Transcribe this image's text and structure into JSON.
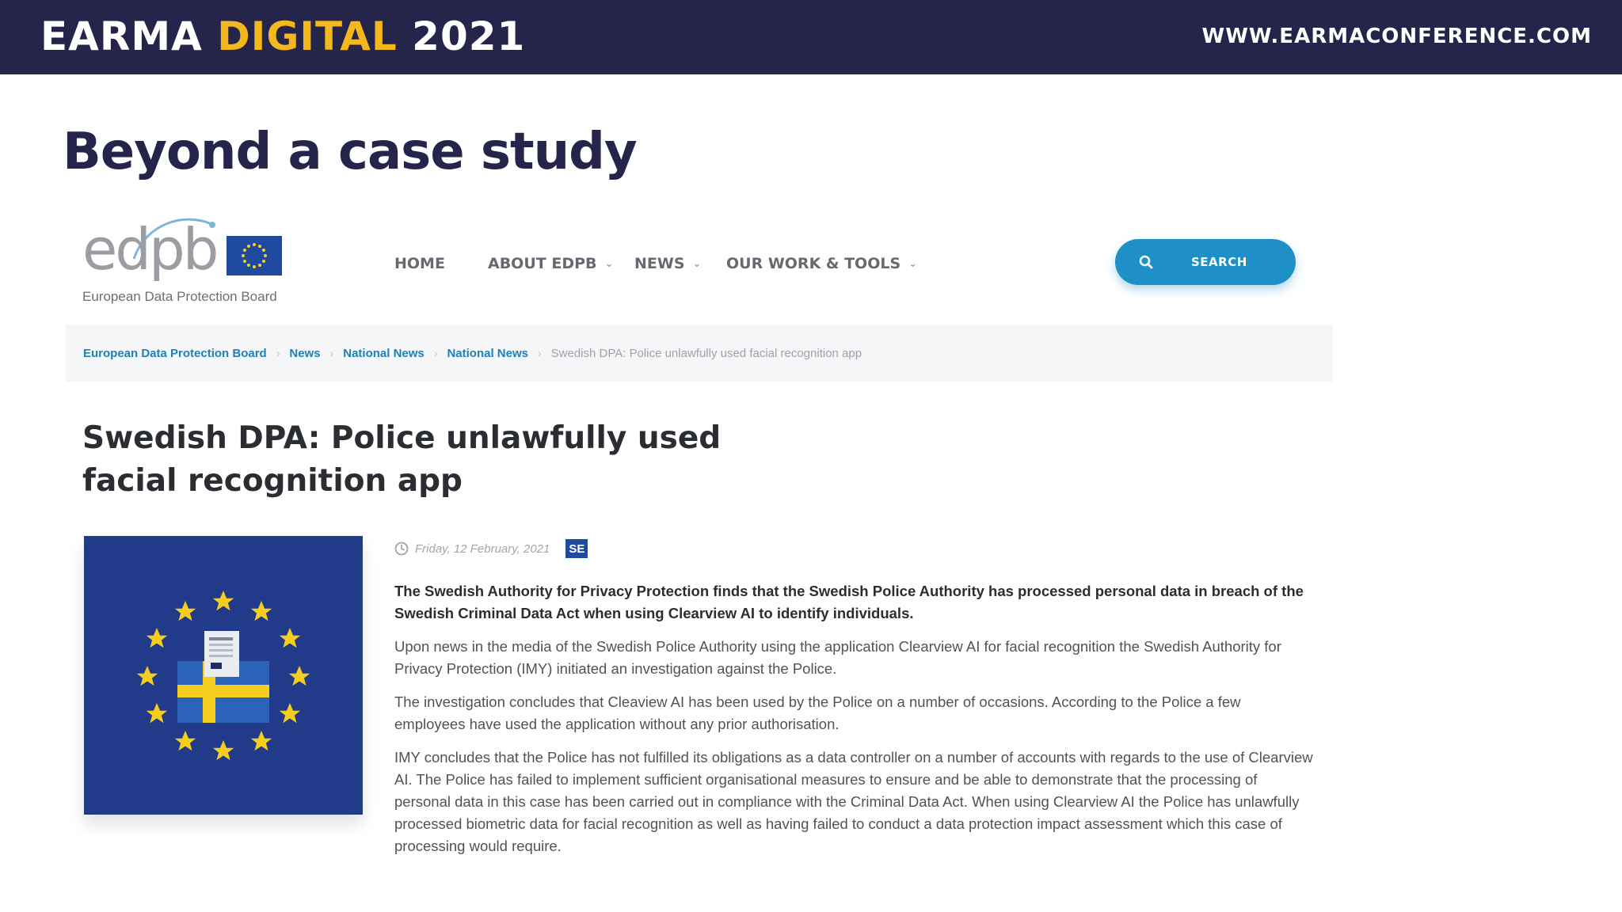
{
  "banner": {
    "title_part1": "EARMA ",
    "title_accent": "DIGITAL",
    "title_part2": " 2021",
    "url": "WWW.EARMACONFERENCE.COM",
    "accent_color": "#f3b81d",
    "background_color": "#25244a"
  },
  "slide": {
    "title": "Beyond a case study"
  },
  "site": {
    "logo_word": "edpb",
    "logo_subtitle": "European Data Protection Board",
    "nav": [
      {
        "label": "HOME",
        "has_dropdown": false
      },
      {
        "label": "ABOUT EDPB",
        "has_dropdown": true
      },
      {
        "label": "NEWS",
        "has_dropdown": true
      },
      {
        "label": "OUR WORK & TOOLS",
        "has_dropdown": true
      }
    ],
    "search_label": "SEARCH",
    "search_icon": "search-icon",
    "accent_color": "#1f8fc8"
  },
  "breadcrumb": {
    "items": [
      "European Data Protection Board",
      "News",
      "National News",
      "National News"
    ],
    "current": "Swedish DPA: Police unlawfully used facial recognition app"
  },
  "article": {
    "title": "Swedish DPA: Police unlawfully used facial recognition app",
    "date": "Friday, 12 February, 2021",
    "date_icon": "clock-icon",
    "country_badge": "SE",
    "lead": "The Swedish Authority for Privacy Protection finds that the Swedish Police Authority has processed personal data in breach of the Swedish Criminal Data Act when using Clearview AI to identify individuals.",
    "paragraphs": [
      "Upon news in the media of the Swedish Police Authority using the application Clearview AI for facial recognition the Swedish Authority for Privacy Protection (IMY) initiated an investigation against the Police.",
      "The investigation concludes that Cleaview AI has been used by the Police on a number of occasions. According to the Police a few employees have used the application without any prior authorisation.",
      "IMY concludes that the Police has not fulfilled its obligations as a data controller on a number of accounts with regards to the use of Clearview AI. The Police has failed to implement sufficient organisational measures to ensure and be able to demonstrate that the processing of personal data in this case has been carried out in compliance with the Criminal Data Act. When using Clearview AI the Police has unlawfully processed biometric data for facial recognition as well as having failed to conduct a data protection impact assessment which this case of processing would require."
    ],
    "image_icon": "eu-stars-swedish-flag-document-icon"
  }
}
